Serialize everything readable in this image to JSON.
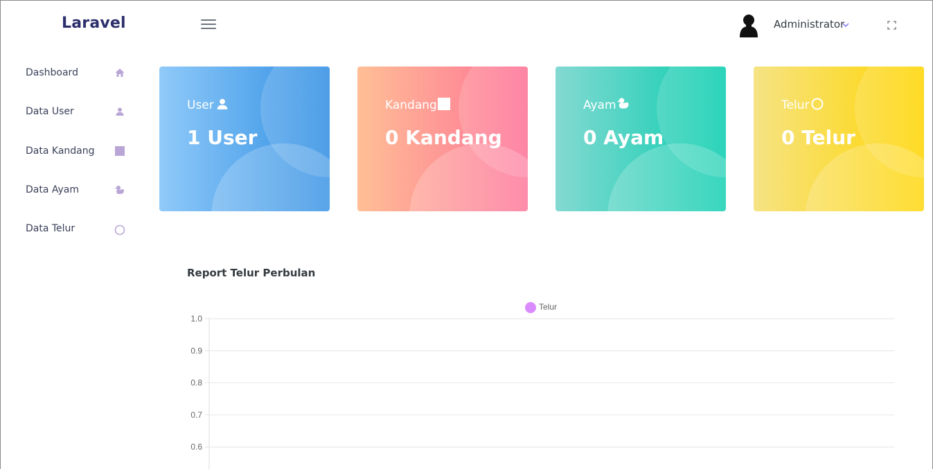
{
  "header": {
    "brand": "Laravel",
    "user_name": "Administrator"
  },
  "sidebar": {
    "items": [
      {
        "label": "Dashboard",
        "icon": "home-icon"
      },
      {
        "label": "Data User",
        "icon": "user-icon"
      },
      {
        "label": "Data Kandang",
        "icon": "square-icon"
      },
      {
        "label": "Data Ayam",
        "icon": "duck-icon"
      },
      {
        "label": "Data Telur",
        "icon": "circle-icon"
      }
    ]
  },
  "cards": [
    {
      "title": "User",
      "value": "1 User",
      "icon": "user-icon",
      "colors": [
        "#90caf9",
        "#2f8ee3"
      ]
    },
    {
      "title": "Kandang",
      "value": "0 Kandang",
      "icon": "square-icon",
      "colors": [
        "#ffbf96",
        "#fe7096"
      ]
    },
    {
      "title": "Ayam",
      "value": "0 Ayam",
      "icon": "duck-icon",
      "colors": [
        "#84d9d2",
        "#07cdae"
      ]
    },
    {
      "title": "Telur",
      "value": "0 Telur",
      "icon": "circle-icon",
      "colors": [
        "#f6e384",
        "#ffd500"
      ]
    }
  ],
  "chart_section": {
    "title": "Report Telur Perbulan"
  },
  "chart_data": {
    "type": "line",
    "title": "",
    "series": [
      {
        "name": "Telur",
        "color": "#da8cff",
        "values": []
      }
    ],
    "y_ticks": [
      "1.0",
      "0.9",
      "0.8",
      "0.7",
      "0.6"
    ],
    "ylim": [
      0.6,
      1.0
    ],
    "grid": true,
    "legend": "top"
  },
  "colors": {
    "brand": "#2c2f6b",
    "sidebar_icon": "#b9a6d6",
    "accent": "#7a6ff0"
  }
}
